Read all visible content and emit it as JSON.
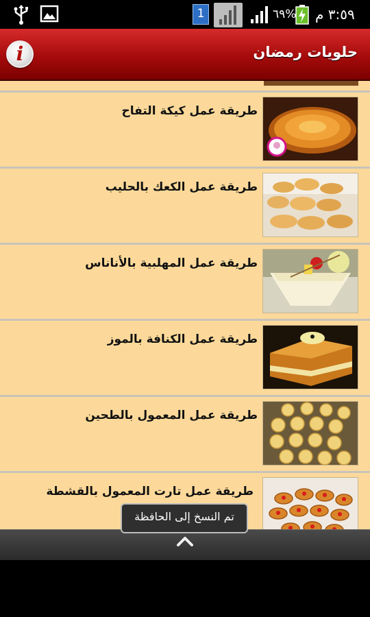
{
  "status_bar": {
    "time": "٣:٥٩ م",
    "battery": "٦٩%",
    "notification_count": "1",
    "icons": [
      "usb-icon",
      "image-icon",
      "sim-icon",
      "signal-icon",
      "battery-icon"
    ]
  },
  "app_bar": {
    "title": "حلويات رمضان",
    "info_glyph": "i"
  },
  "recipes": [
    {
      "title": "طريقة عمل كيكة التفاح",
      "image": "apple-cake"
    },
    {
      "title": "طريقة عمل الكعك بالحليب",
      "image": "milk-cookies"
    },
    {
      "title": "طريقة عمل المهلبية بالأناناس",
      "image": "pineapple-pudding"
    },
    {
      "title": "طريقة عمل الكنافة بالموز",
      "image": "banana-kunafa"
    },
    {
      "title": "طريقة عمل المعمول بالطحين",
      "image": "flour-maamoul"
    },
    {
      "title": "طريقة عمل تارت المعمول بالقشطة",
      "image": "cream-maamoul-tart"
    }
  ],
  "toast": {
    "message": "تم النسخ إلى الحافظة"
  },
  "colors": {
    "list_background": "#fcd99a",
    "app_bar_red": "#a60b0b",
    "divider": "#c8c3ba"
  }
}
